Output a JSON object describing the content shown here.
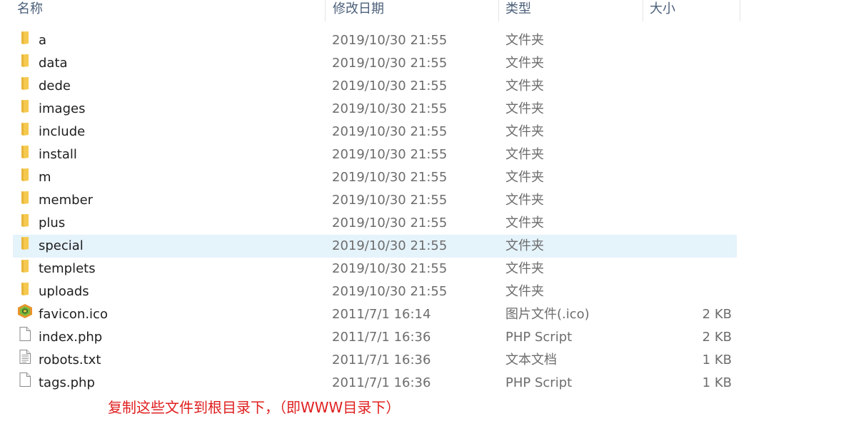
{
  "columns": {
    "name": "名称",
    "date": "修改日期",
    "type": "类型",
    "size": "大小"
  },
  "files": [
    {
      "name": "a",
      "date": "2019/10/30 21:55",
      "type": "文件夹",
      "size": "",
      "icon": "folder-icon"
    },
    {
      "name": "data",
      "date": "2019/10/30 21:55",
      "type": "文件夹",
      "size": "",
      "icon": "folder-icon"
    },
    {
      "name": "dede",
      "date": "2019/10/30 21:55",
      "type": "文件夹",
      "size": "",
      "icon": "folder-icon"
    },
    {
      "name": "images",
      "date": "2019/10/30 21:55",
      "type": "文件夹",
      "size": "",
      "icon": "folder-icon"
    },
    {
      "name": "include",
      "date": "2019/10/30 21:55",
      "type": "文件夹",
      "size": "",
      "icon": "folder-icon"
    },
    {
      "name": "install",
      "date": "2019/10/30 21:55",
      "type": "文件夹",
      "size": "",
      "icon": "folder-icon"
    },
    {
      "name": "m",
      "date": "2019/10/30 21:55",
      "type": "文件夹",
      "size": "",
      "icon": "folder-icon"
    },
    {
      "name": "member",
      "date": "2019/10/30 21:55",
      "type": "文件夹",
      "size": "",
      "icon": "folder-icon"
    },
    {
      "name": "plus",
      "date": "2019/10/30 21:55",
      "type": "文件夹",
      "size": "",
      "icon": "folder-icon"
    },
    {
      "name": "special",
      "date": "2019/10/30 21:55",
      "type": "文件夹",
      "size": "",
      "icon": "folder-icon"
    },
    {
      "name": "templets",
      "date": "2019/10/30 21:55",
      "type": "文件夹",
      "size": "",
      "icon": "folder-icon"
    },
    {
      "name": "uploads",
      "date": "2019/10/30 21:55",
      "type": "文件夹",
      "size": "",
      "icon": "folder-icon"
    },
    {
      "name": "favicon.ico",
      "date": "2011/7/1 16:14",
      "type": "图片文件(.ico)",
      "size": "2 KB",
      "icon": "image-file-icon"
    },
    {
      "name": "index.php",
      "date": "2011/7/1 16:36",
      "type": "PHP Script",
      "size": "2 KB",
      "icon": "blank-file-icon"
    },
    {
      "name": "robots.txt",
      "date": "2011/7/1 16:36",
      "type": "文本文档",
      "size": "1 KB",
      "icon": "text-file-icon"
    },
    {
      "name": "tags.php",
      "date": "2011/7/1 16:36",
      "type": "PHP Script",
      "size": "1 KB",
      "icon": "blank-file-icon"
    }
  ],
  "annotation": "复制这些文件到根目录下，（即WWW目录下）",
  "colors": {
    "selected_row": "#e5f3fb",
    "annotation_text": "#e02020",
    "folder": "#f5c74e"
  }
}
